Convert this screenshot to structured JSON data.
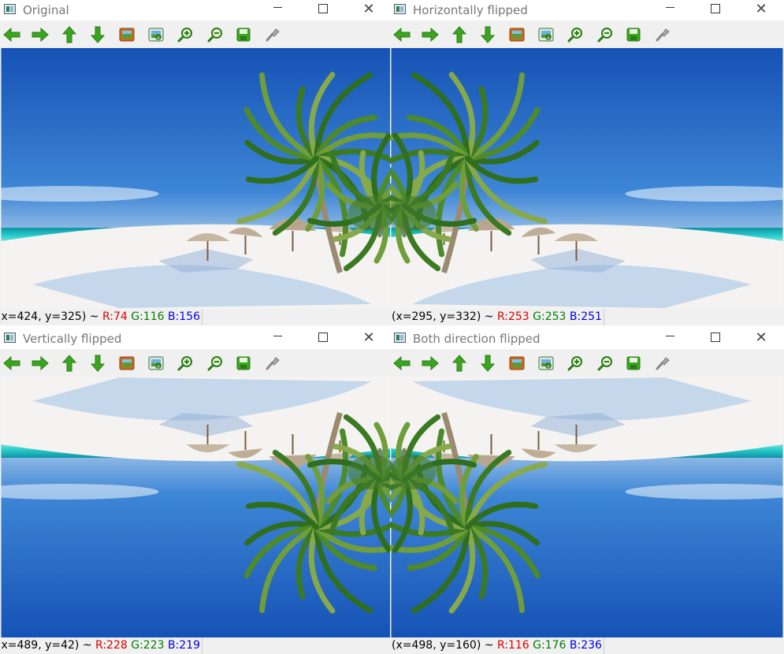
{
  "windows": [
    {
      "title": "Original",
      "status": {
        "coord": "(x=424, y=325) ~",
        "r": "R:74",
        "g": "G:116",
        "b": "B:156"
      },
      "flip": "none"
    },
    {
      "title": "Horizontally flipped",
      "status": {
        "coord": "(x=295, y=332) ~",
        "r": "R:253",
        "g": "G:253",
        "b": "B:251"
      },
      "flip": "h"
    },
    {
      "title": "Vertically flipped",
      "status": {
        "coord": "(x=489, y=42) ~",
        "r": "R:228",
        "g": "G:223",
        "b": "B:219"
      },
      "flip": "v"
    },
    {
      "title": "Both direction flipped",
      "status": {
        "coord": "(x=498, y=160) ~",
        "r": "R:116",
        "g": "G:176",
        "b": "B:236"
      },
      "flip": "hv"
    }
  ],
  "toolbar_icons": [
    "pan-left-icon",
    "pan-right-icon",
    "pan-up-icon",
    "pan-down-icon",
    "zoom-fit-icon",
    "zoom-region-icon",
    "zoom-in-icon",
    "zoom-out-icon",
    "save-icon",
    "properties-icon"
  ],
  "colors": {
    "arrow_green": "#3aa51f",
    "sky_top": "#1f63bf",
    "sky_horizon": "#bcd6ee",
    "sea": "#1fb7c0",
    "sand": "#f4f3f1"
  }
}
